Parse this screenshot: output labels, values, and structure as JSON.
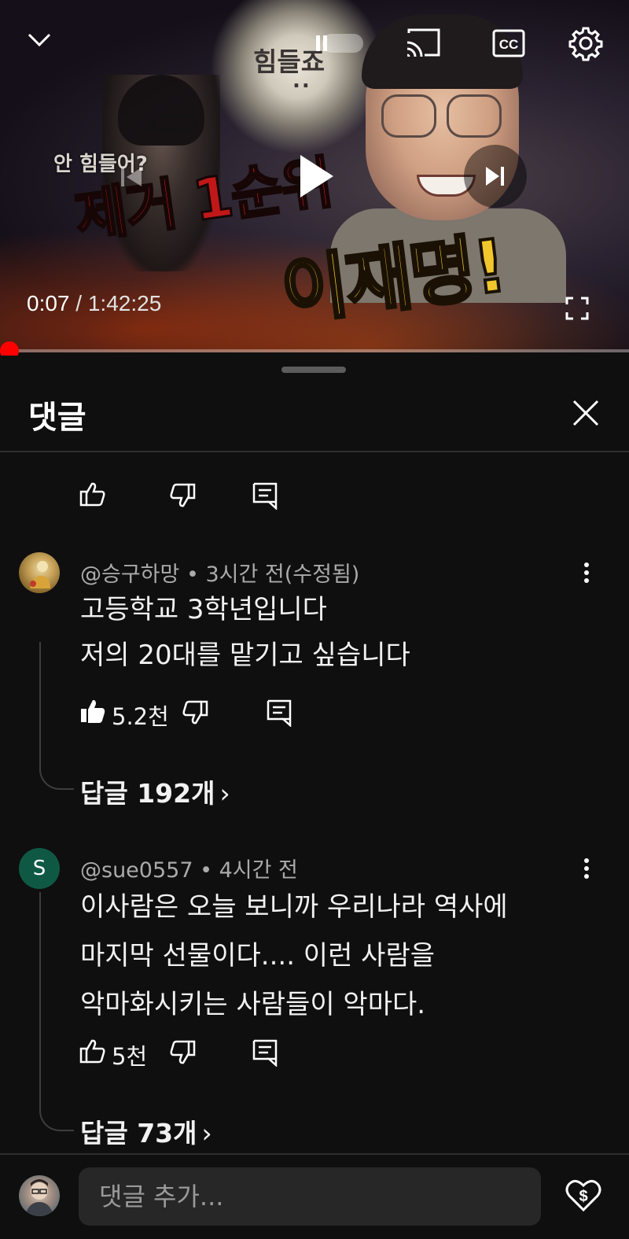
{
  "video": {
    "bubble_text": "힘들죠",
    "bubble_dots": "..",
    "side_caption": "안 힘들어?",
    "title_line1": "제거 1순위",
    "title_line2": "이재명!",
    "current_time": "0:07",
    "separator": " / ",
    "duration": "1:42:25",
    "progress_fraction": 0.0011
  },
  "icons": {
    "collapse": "chevron-down-icon",
    "pause": "pause-icon",
    "cast": "cast-icon",
    "captions": "closed-captions-icon",
    "settings": "gear-icon",
    "previous": "skip-previous-icon",
    "play": "play-icon",
    "next": "skip-next-icon",
    "fullscreen": "fullscreen-icon"
  },
  "captions_label": "CC",
  "comments_panel": {
    "title": "댓글",
    "comments": [
      {
        "author": "@승구하망",
        "time": "3시간 전(수정됨)",
        "lines": [
          "고등학교 3학년입니다",
          "저의 20대를 맡기고 싶습니다"
        ],
        "likes": "5.2천",
        "liked": true,
        "replies_label": "답글 192개"
      },
      {
        "author": "@sue0557",
        "avatar_letter": "S",
        "time": "4시간 전",
        "lines": [
          "이사람은 오늘 보니까 우리나라 역사에",
          "마지막 선물이다.... 이런 사람을",
          "악마화시키는 사람들이 악마다."
        ],
        "likes": "5천",
        "liked": false,
        "replies_label": "답글 73개"
      }
    ],
    "meta_separator": " • ",
    "replies_chevron": "›",
    "add_comment_placeholder": "댓글 추가..."
  },
  "colors": {
    "background": "#0f0f0f",
    "progress": "#ff0000",
    "avatar_s": "#0f5944",
    "secondary_text": "#aaaaaa"
  }
}
